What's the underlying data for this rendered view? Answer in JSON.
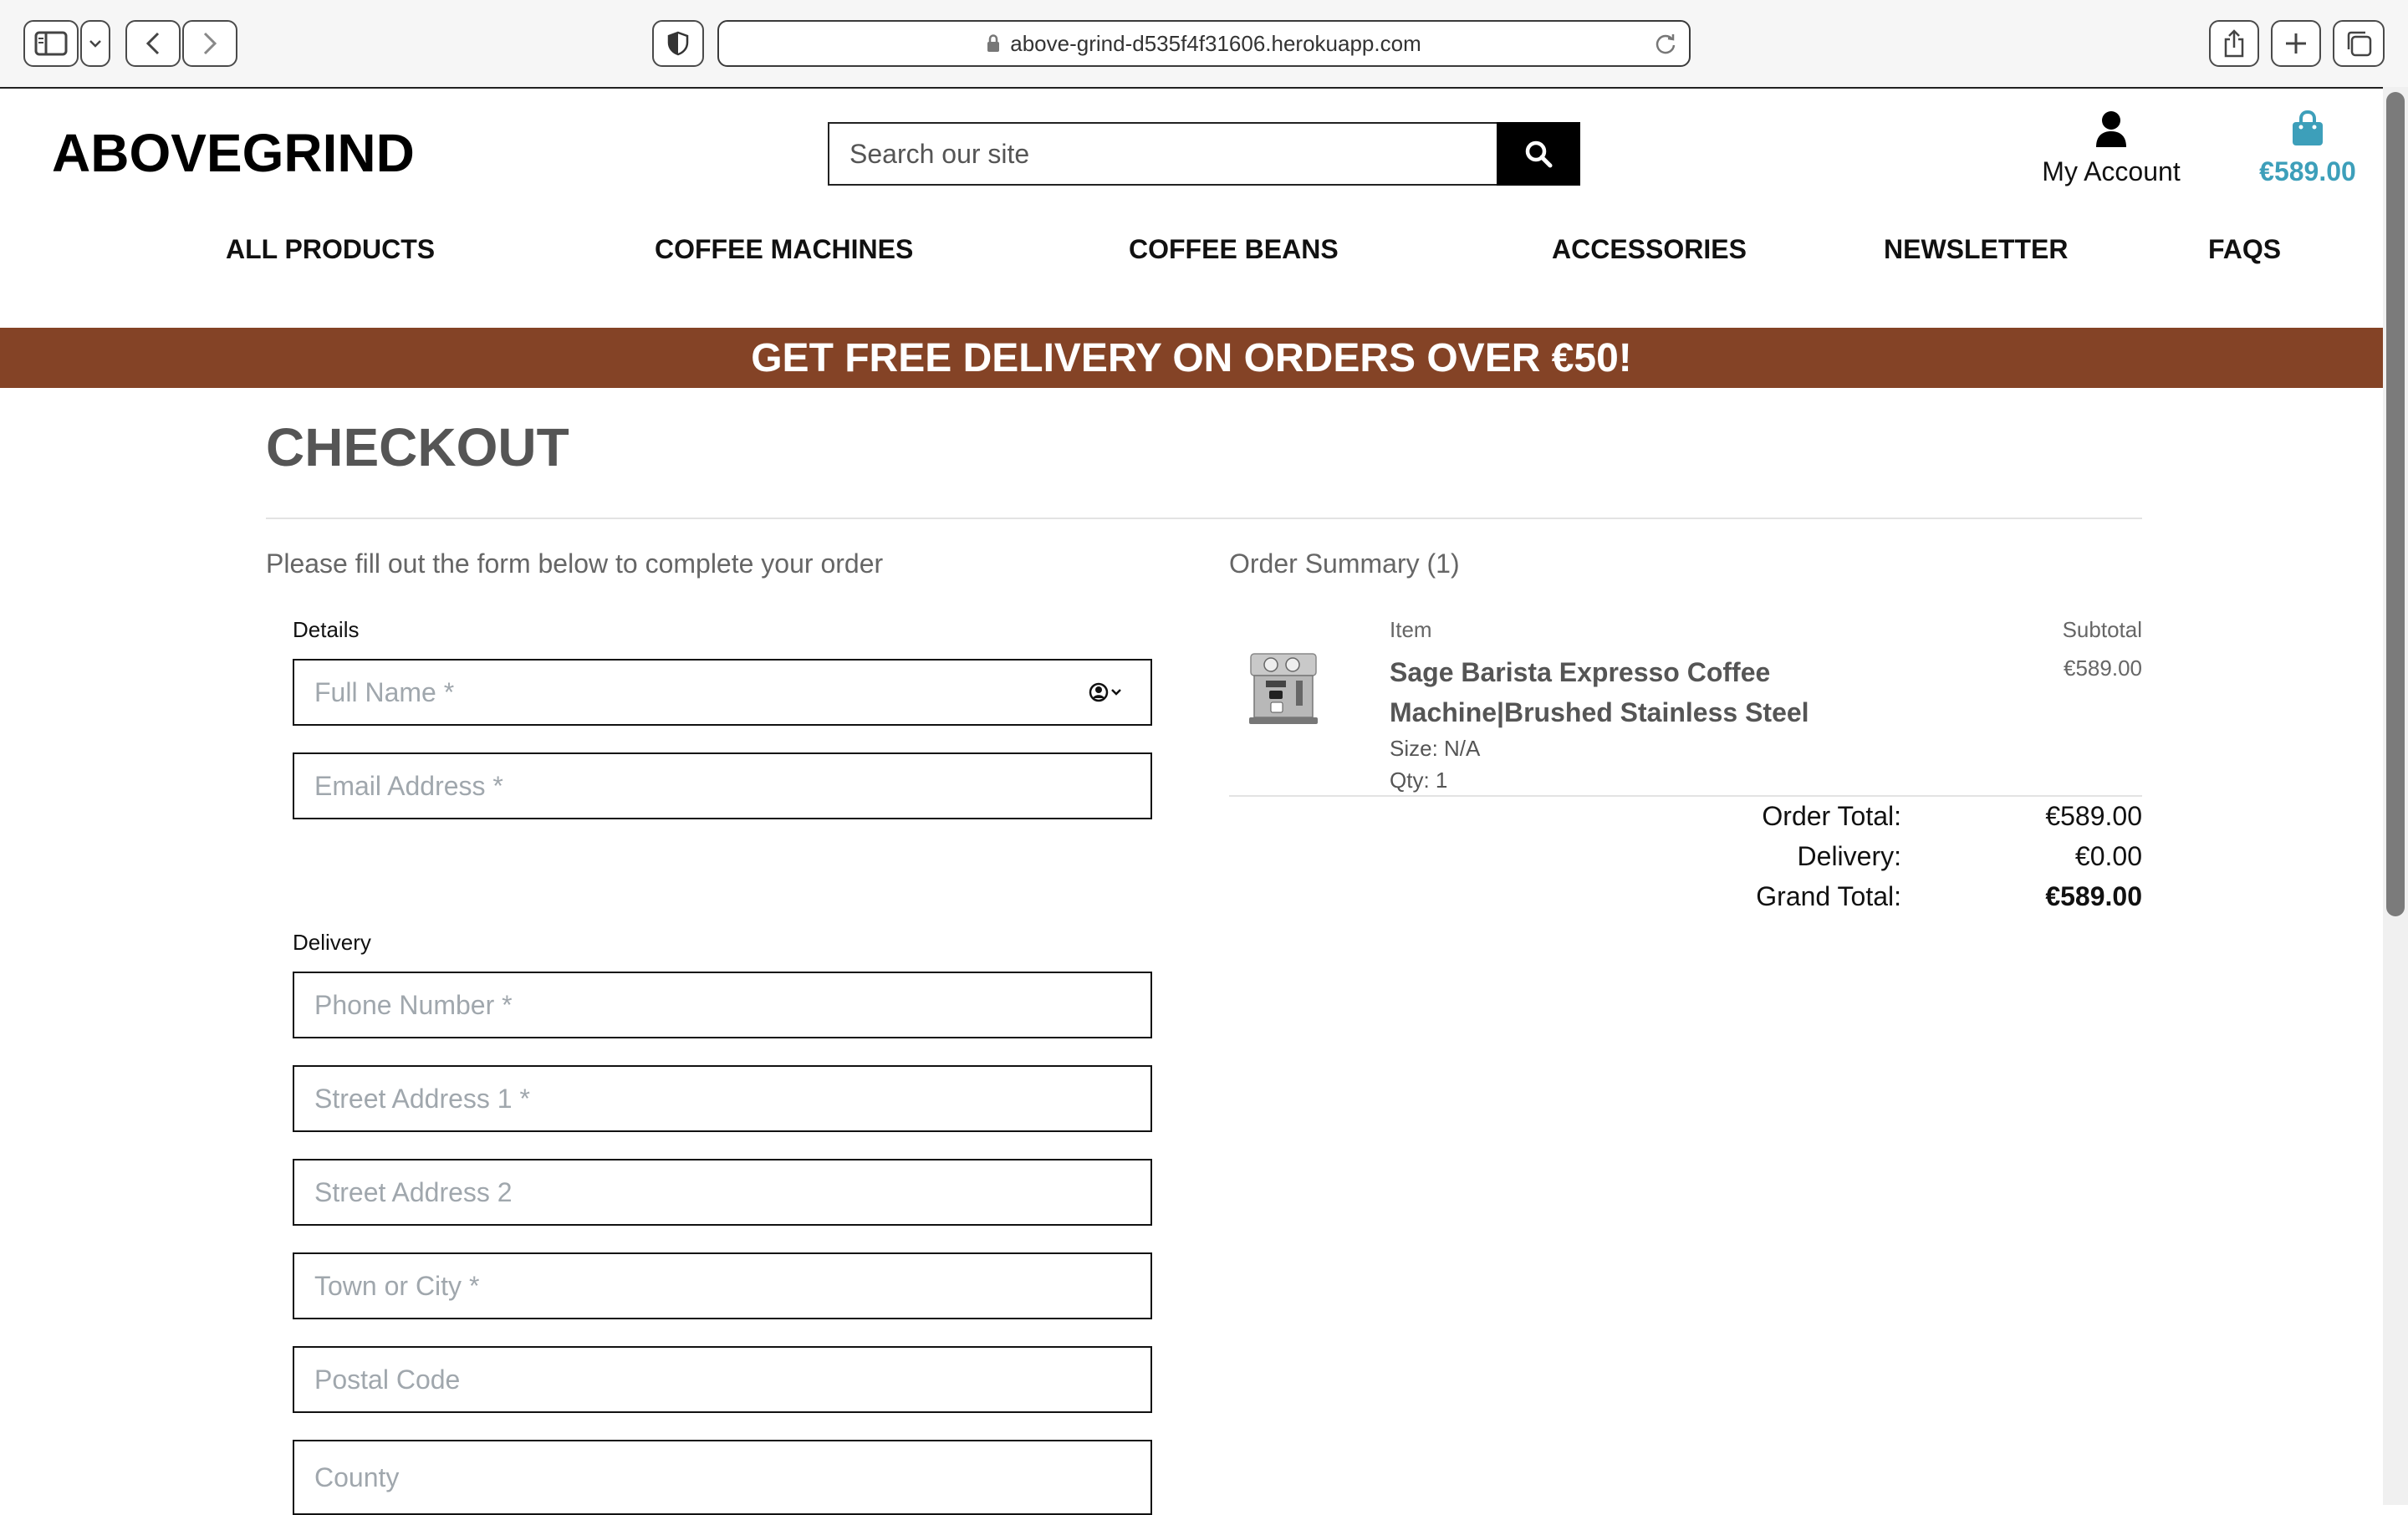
{
  "browser": {
    "url": "above-grind-d535f4f31606.herokuapp.com"
  },
  "site": {
    "logo": "ABOVEGRIND",
    "search_placeholder": "Search our site",
    "account_label": "My Account",
    "bag_total": "€589.00",
    "accent_color": "#3d9fba"
  },
  "nav": {
    "items": [
      "ALL PRODUCTS",
      "COFFEE MACHINES",
      "COFFEE BEANS",
      "ACCESSORIES",
      "NEWSLETTER",
      "FAQS"
    ]
  },
  "banner": {
    "text": "GET FREE DELIVERY ON ORDERS OVER €50!",
    "color": "#844326"
  },
  "checkout": {
    "title": "CHECKOUT",
    "intro": "Please fill out the form below to complete your order",
    "details_label": "Details",
    "delivery_label": "Delivery",
    "fields": {
      "full_name": "Full Name *",
      "email": "Email Address *",
      "phone": "Phone Number *",
      "street1": "Street Address 1 *",
      "street2": "Street Address 2",
      "town": "Town or City *",
      "postcode": "Postal Code",
      "county": "County"
    }
  },
  "summary": {
    "title": "Order Summary (1)",
    "col_item": "Item",
    "col_subtotal": "Subtotal",
    "product": {
      "name": "Sage Barista Expresso Coffee Machine|Brushed Stainless Steel",
      "size": "Size: N/A",
      "qty": "Qty: 1",
      "subtotal": "€589.00"
    },
    "order_total_label": "Order Total:",
    "order_total": "€589.00",
    "delivery_label": "Delivery:",
    "delivery": "€0.00",
    "grand_total_label": "Grand Total:",
    "grand_total": "€589.00"
  }
}
